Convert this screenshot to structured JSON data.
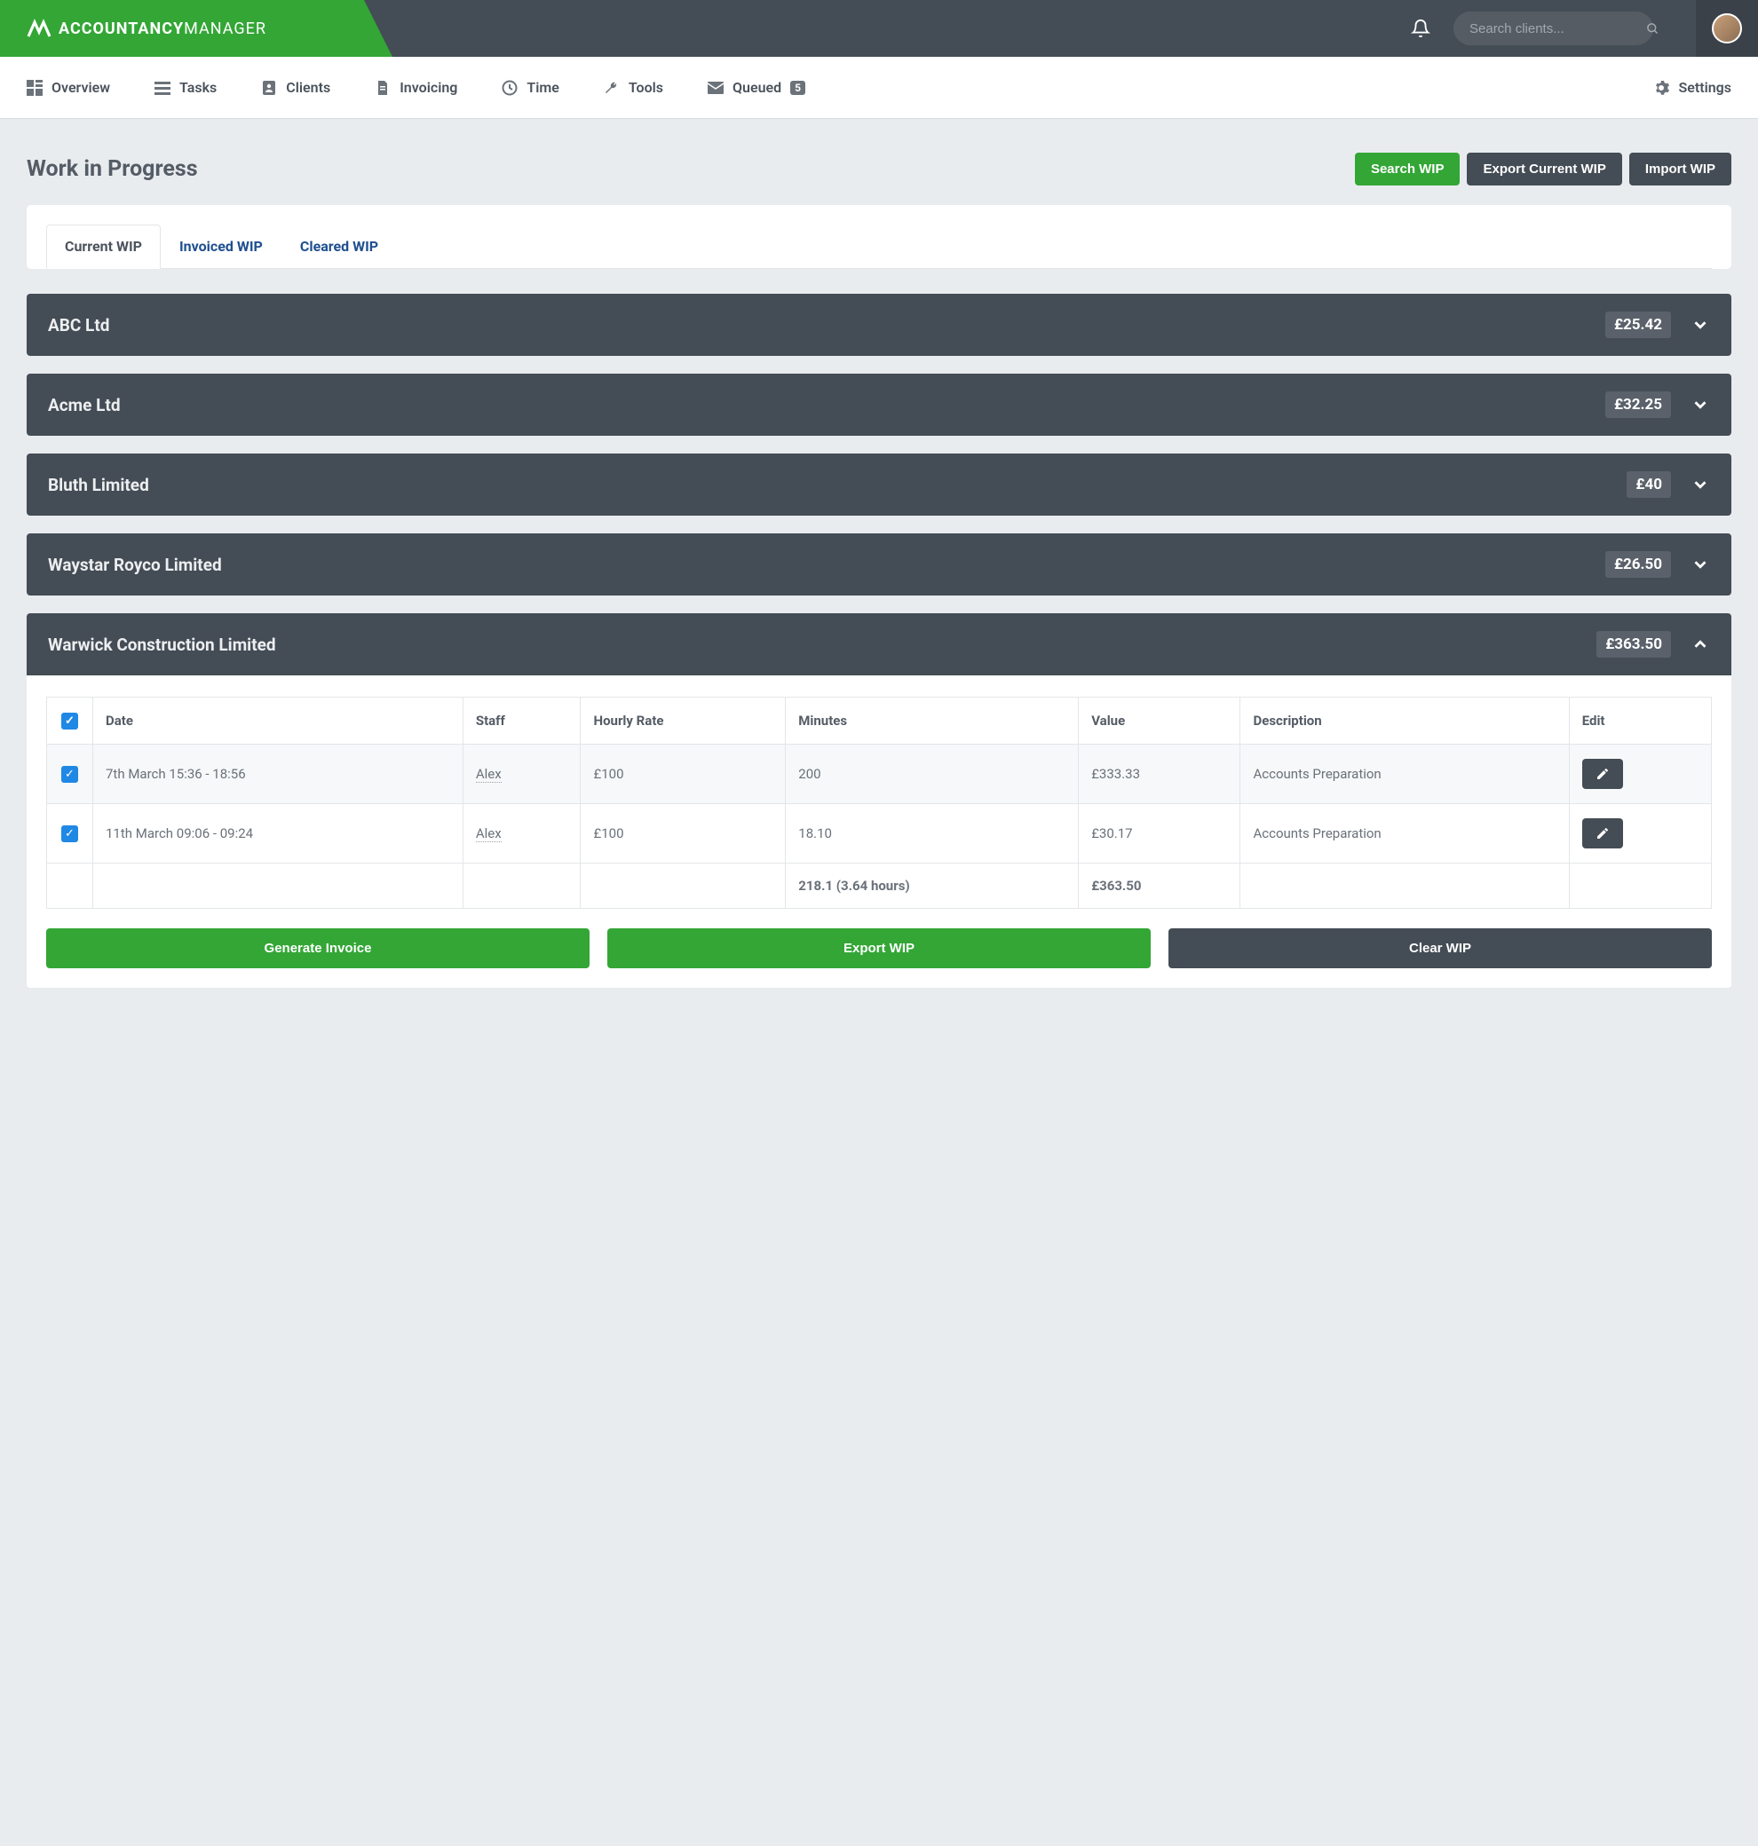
{
  "app": {
    "logo_bold": "ACCOUNTANCY",
    "logo_light": "MANAGER"
  },
  "search": {
    "placeholder": "Search clients..."
  },
  "nav": {
    "overview": "Overview",
    "tasks": "Tasks",
    "clients": "Clients",
    "invoicing": "Invoicing",
    "time": "Time",
    "tools": "Tools",
    "queued": "Queued",
    "queued_count": "5",
    "settings": "Settings"
  },
  "page": {
    "title": "Work in Progress"
  },
  "buttons": {
    "search_wip": "Search WIP",
    "export_current_wip": "Export Current WIP",
    "import_wip": "Import WIP",
    "generate_invoice": "Generate Invoice",
    "export_wip": "Export WIP",
    "clear_wip": "Clear WIP"
  },
  "tabs": {
    "current": "Current WIP",
    "invoiced": "Invoiced WIP",
    "cleared": "Cleared WIP"
  },
  "clients": [
    {
      "name": "ABC Ltd",
      "amount": "£25.42",
      "expanded": false
    },
    {
      "name": "Acme Ltd",
      "amount": "£32.25",
      "expanded": false
    },
    {
      "name": "Bluth Limited",
      "amount": "£40",
      "expanded": false
    },
    {
      "name": "Waystar Royco Limited",
      "amount": "£26.50",
      "expanded": false
    },
    {
      "name": "Warwick Construction Limited",
      "amount": "£363.50",
      "expanded": true
    }
  ],
  "table": {
    "headers": {
      "date": "Date",
      "staff": "Staff",
      "rate": "Hourly Rate",
      "minutes": "Minutes",
      "value": "Value",
      "description": "Description",
      "edit": "Edit"
    },
    "rows": [
      {
        "date": "7th March 15:36 - 18:56",
        "staff": "Alex",
        "rate": "£100",
        "minutes": "200",
        "value": "£333.33",
        "description": "Accounts Preparation"
      },
      {
        "date": "11th March 09:06 - 09:24",
        "staff": "Alex",
        "rate": "£100",
        "minutes": "18.10",
        "value": "£30.17",
        "description": "Accounts Preparation"
      }
    ],
    "totals": {
      "minutes": "218.1 (3.64 hours)",
      "value": "£363.50"
    }
  }
}
